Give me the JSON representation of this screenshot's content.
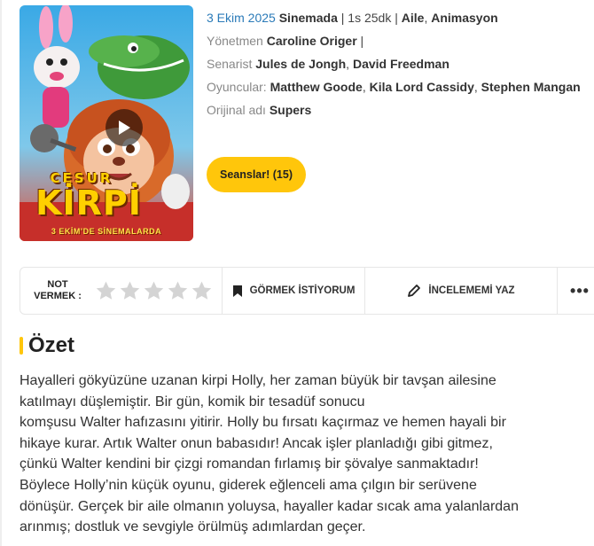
{
  "poster": {
    "title_small": "CESUR",
    "title_big": "KİRPİ",
    "date_banner": "3 EKİM'DE SİNEMALARDA"
  },
  "info": {
    "release_date": "3 Ekim 2025",
    "status": "Sinemada",
    "separator": "|",
    "duration": "1s 25dk",
    "genre1": "Aile",
    "genre2": "Animasyon",
    "director_label": "Yönetmen",
    "director": "Caroline Origer",
    "writer_label": "Senarist",
    "writer1": "Jules de Jongh",
    "writer2": "David Freedman",
    "cast_label": "Oyuncular:",
    "cast1": "Matthew Goode",
    "cast2": "Kila Lord Cassidy",
    "cast3": "Stephen Mangan",
    "original_label": "Orijinal adı",
    "original_title": "Supers"
  },
  "sessions_button": "Seanslar! (15)",
  "action_bar": {
    "rate_line1": "NOT",
    "rate_line2": "VERMEK :",
    "stars_filled": 0,
    "stars_total": 5,
    "watch_label": "GÖRMEK İSTİYORUM",
    "review_label": "İNCELEMEMİ YAZ",
    "more_label": "•••"
  },
  "summary": {
    "title": "Özet",
    "lines": [
      "Hayalleri gökyüzüne uzanan kirpi Holly, her zaman büyük bir tavşan ailesine",
      "katılmayı düşlemiştir. Bir gün, komik bir tesadüf sonucu",
      "komşusu Walter hafızasını yitirir. Holly bu fırsatı kaçırmaz ve hemen hayali bir",
      "hikaye kurar. Artık Walter onun babasıdır! Ancak işler planladığı gibi gitmez,",
      "çünkü Walter kendini bir çizgi romandan fırlamış bir şövalye sanmaktadır!",
      "Böylece Holly’nin küçük oyunu, giderek eğlenceli ama çılgın bir serüvene",
      "dönüşür. Gerçek bir aile olmanın yoluysa, hayaller kadar sıcak ama yalanlardan",
      "arınmış; dostluk ve sevgiyle örülmüş adımlardan geçer."
    ]
  },
  "colors": {
    "accent": "#ffc60b",
    "link": "#2a7ab8"
  }
}
